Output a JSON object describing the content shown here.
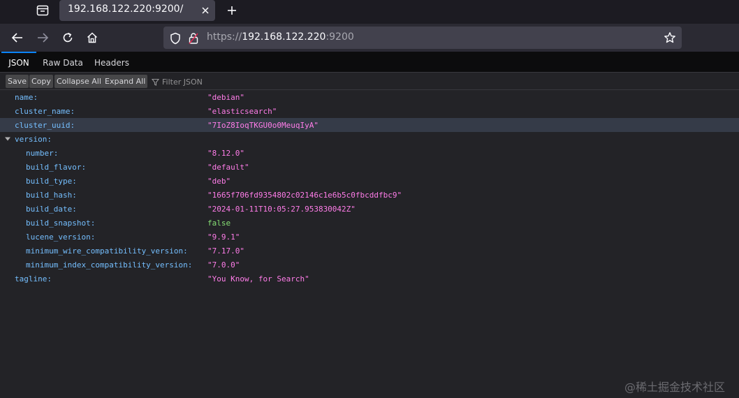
{
  "browser": {
    "tab_title": "192.168.122.220:9200/",
    "url_scheme": "https://",
    "url_host": "192.168.122.220",
    "url_port": ":9200",
    "icons": [
      "tab-list-icon",
      "close-icon",
      "plus-icon",
      "back-arrow-icon",
      "forward-arrow-icon",
      "reload-icon",
      "home-icon",
      "shield-icon",
      "lock-icon",
      "star-icon"
    ]
  },
  "viewer": {
    "tabs": [
      {
        "label": "JSON",
        "selected": true
      },
      {
        "label": "Raw Data",
        "selected": false
      },
      {
        "label": "Headers",
        "selected": false
      }
    ],
    "toolbar": {
      "save": "Save",
      "copy": "Copy",
      "collapse_all": "Collapse All",
      "expand_all": "Expand All",
      "filter_placeholder": "Filter JSON"
    }
  },
  "json": {
    "name_key": "name:",
    "name_val": "\"debian\"",
    "cluster_name_key": "cluster_name:",
    "cluster_name_val": "\"elasticsearch\"",
    "cluster_uuid_key": "cluster_uuid:",
    "cluster_uuid_val": "\"7IoZ8IoqTKGU0o0MeuqIyA\"",
    "version_key": "version:",
    "version": {
      "number_key": "number:",
      "number_val": "\"8.12.0\"",
      "build_flavor_key": "build_flavor:",
      "build_flavor_val": "\"default\"",
      "build_type_key": "build_type:",
      "build_type_val": "\"deb\"",
      "build_hash_key": "build_hash:",
      "build_hash_val": "\"1665f706fd9354802c02146c1e6b5c0fbcddfbc9\"",
      "build_date_key": "build_date:",
      "build_date_val": "\"2024-01-11T10:05:27.953830042Z\"",
      "build_snapshot_key": "build_snapshot:",
      "build_snapshot_val": "false",
      "lucene_version_key": "lucene_version:",
      "lucene_version_val": "\"9.9.1\"",
      "min_wire_key": "minimum_wire_compatibility_version:",
      "min_wire_val": "\"7.17.0\"",
      "min_index_key": "minimum_index_compatibility_version:",
      "min_index_val": "\"7.0.0\""
    },
    "tagline_key": "tagline:",
    "tagline_val": "\"You Know, for Search\""
  },
  "colors": {
    "key": "#75bfff",
    "string": "#ff7de9",
    "boolean": "#86de74",
    "selected_row": "#353b48",
    "accent": "#0a84ff"
  },
  "watermark": "@稀土掘金技术社区"
}
